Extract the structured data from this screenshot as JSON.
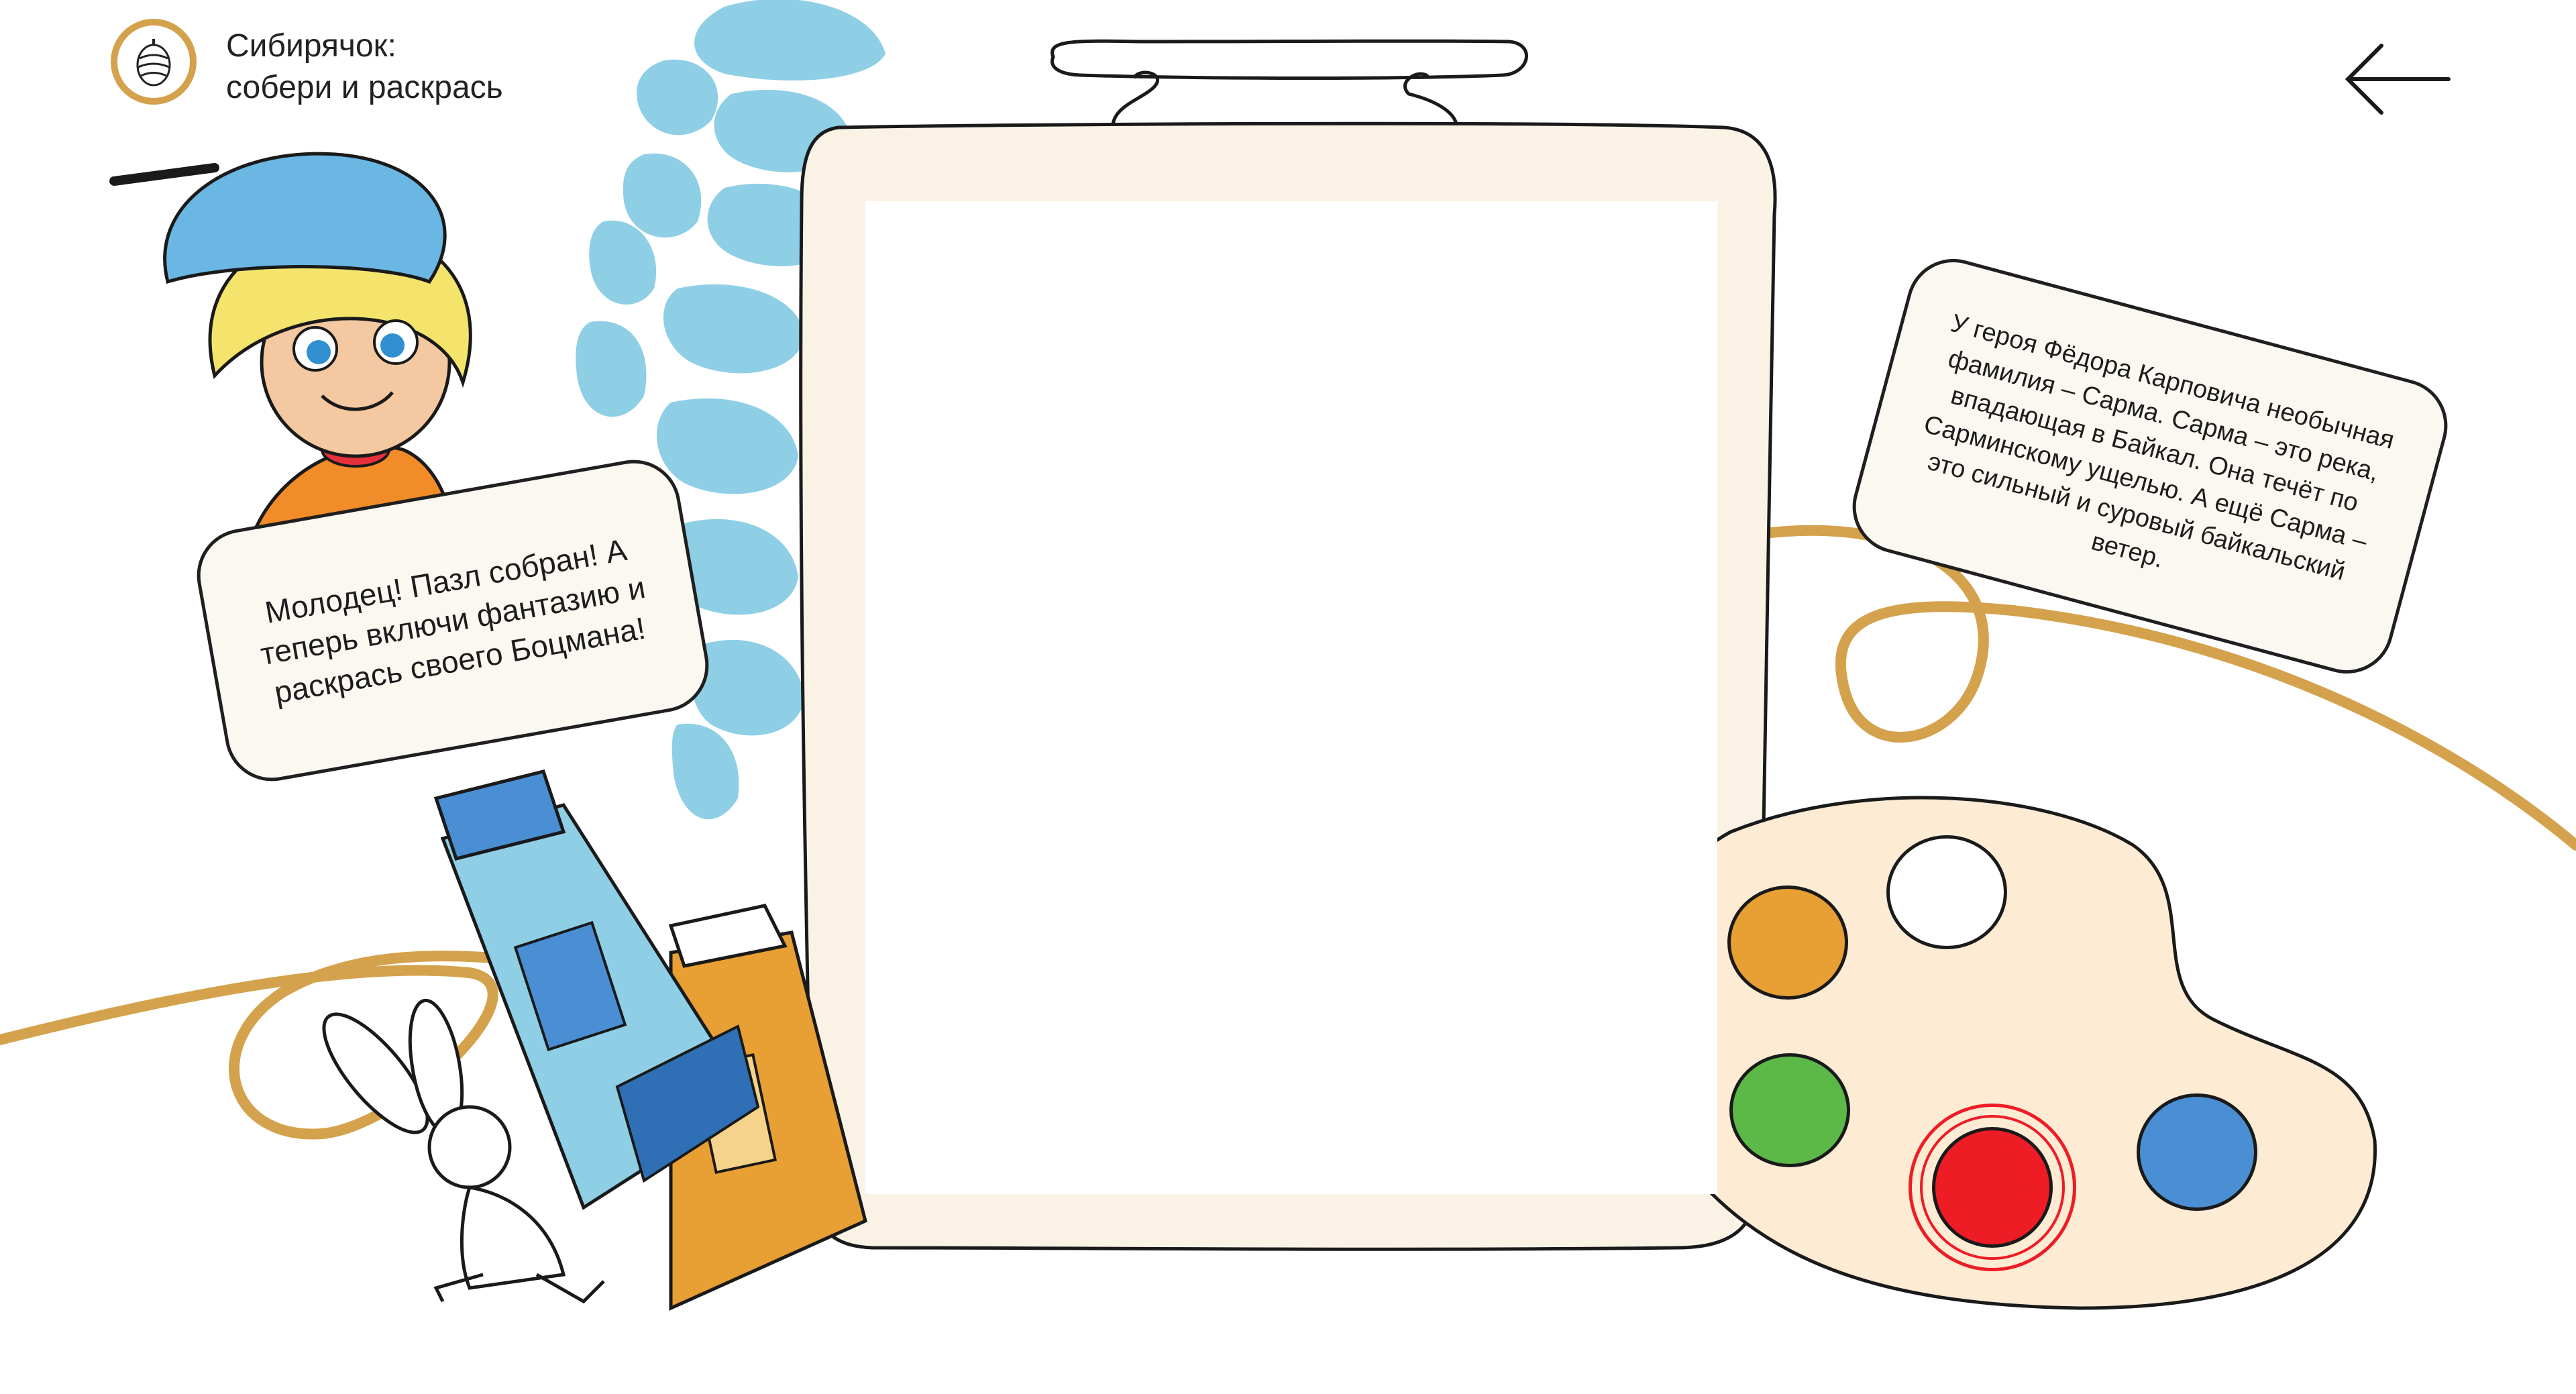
{
  "header": {
    "title_line1": "Сибирячок:",
    "title_line2": "собери и раскрась",
    "logo_icon": "pine-cone-icon",
    "back_icon": "arrow-left-icon"
  },
  "speech": {
    "left": "Молодец! Пазл собран! А теперь включи фантазию и раскрась своего Боцмана!",
    "right": "У героя Фёдора Карповича необычная фамилия – Сарма. Сарма – это река, впадающая в Байкал. Она течёт по Сарминскому ущелью. А ещё Сарма – это сильный и суровый байкальский ветер."
  },
  "palette": {
    "colors": [
      {
        "name": "orange",
        "hex": "#e89f33",
        "selected": false
      },
      {
        "name": "white",
        "hex": "#ffffff",
        "selected": false
      },
      {
        "name": "green",
        "hex": "#5cb947",
        "selected": false
      },
      {
        "name": "red",
        "hex": "#ee1c25",
        "selected": true
      },
      {
        "name": "blue",
        "hex": "#4a8fd3",
        "selected": false
      }
    ]
  },
  "theme": {
    "gold_line": "#d4a24c",
    "light_blue": "#8fcfe6",
    "canvas_cream": "#fbf2e6"
  }
}
